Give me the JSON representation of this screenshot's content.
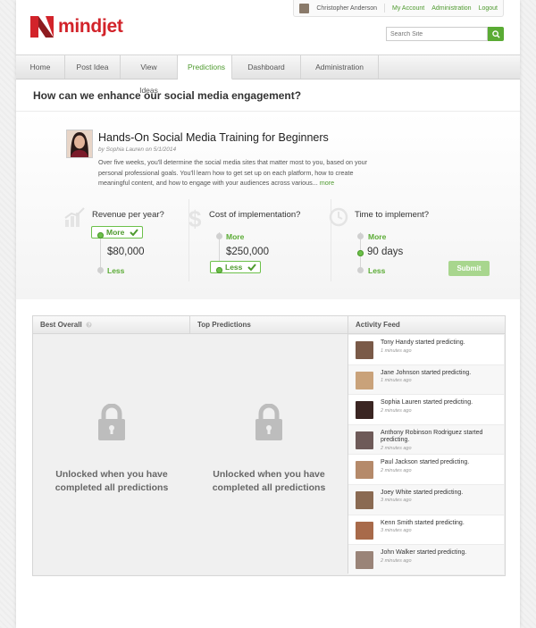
{
  "header": {
    "user_name": "Christopher Anderson",
    "links": [
      "My Account",
      "Administration",
      "Logout"
    ],
    "logo_text": "mindjet",
    "search_placeholder": "Search Site"
  },
  "nav": {
    "tabs": [
      "Home",
      "Post Idea",
      "View Ideas",
      "Predictions",
      "Dashboard",
      "Administration"
    ],
    "active": "Predictions"
  },
  "question": "How can we enhance our social media engagement?",
  "idea": {
    "title": "Hands-On Social Media Training for Beginners",
    "byline": "by Sophia Lauren on 5/1/2014",
    "description": "Over five weeks, you'll determine the social media sites that matter most to you, based on your personal professional goals. You'll learn how to get set up on each platform, how to create meaningful content, and how to engage with your audiences across various...",
    "more_link": "more"
  },
  "criteria": [
    {
      "label": "Revenue per year?",
      "icon": "chart-icon",
      "more": "More",
      "value": "$80,000",
      "less": "Less",
      "selected": "More"
    },
    {
      "label": "Cost of implementation?",
      "icon": "dollar-icon",
      "more": "More",
      "value": "$250,000",
      "less": "Less",
      "selected": "Less"
    },
    {
      "label": "Time to implement?",
      "icon": "clock-icon",
      "more": "More",
      "value": "90 days",
      "less": "Less",
      "selected": "Middle"
    }
  ],
  "submit_label": "Submit",
  "panels": {
    "best_overall": {
      "title": "Best Overall",
      "locked_line1": "Unlocked when you have",
      "locked_line2": "completed all predictions"
    },
    "top_predictions": {
      "title": "Top Predictions",
      "locked_line1": "Unlocked when you have",
      "locked_line2": "completed all predictions"
    },
    "activity_feed": {
      "title": "Activity Feed",
      "items": [
        {
          "text": "Tony Handy started predicting.",
          "time": "1 minutes ago"
        },
        {
          "text": "Jane Johnson started predicting.",
          "time": "1 minutes ago"
        },
        {
          "text": "Sophia Lauren started predicting.",
          "time": "2 minutes ago"
        },
        {
          "text": "Anthony Robinson Rodriguez started predicting.",
          "time": "2 minutes ago"
        },
        {
          "text": "Paul Jackson started predicting.",
          "time": "2 minutes ago"
        },
        {
          "text": "Joey White started predicting.",
          "time": "3 minutes ago"
        },
        {
          "text": "Kenn Smith started predicting.",
          "time": "3 minutes ago"
        },
        {
          "text": "John Walker started predicting.",
          "time": "2 minutes ago"
        }
      ]
    }
  },
  "colors": {
    "brand_red": "#d2232a",
    "accent_green": "#5aab34"
  }
}
